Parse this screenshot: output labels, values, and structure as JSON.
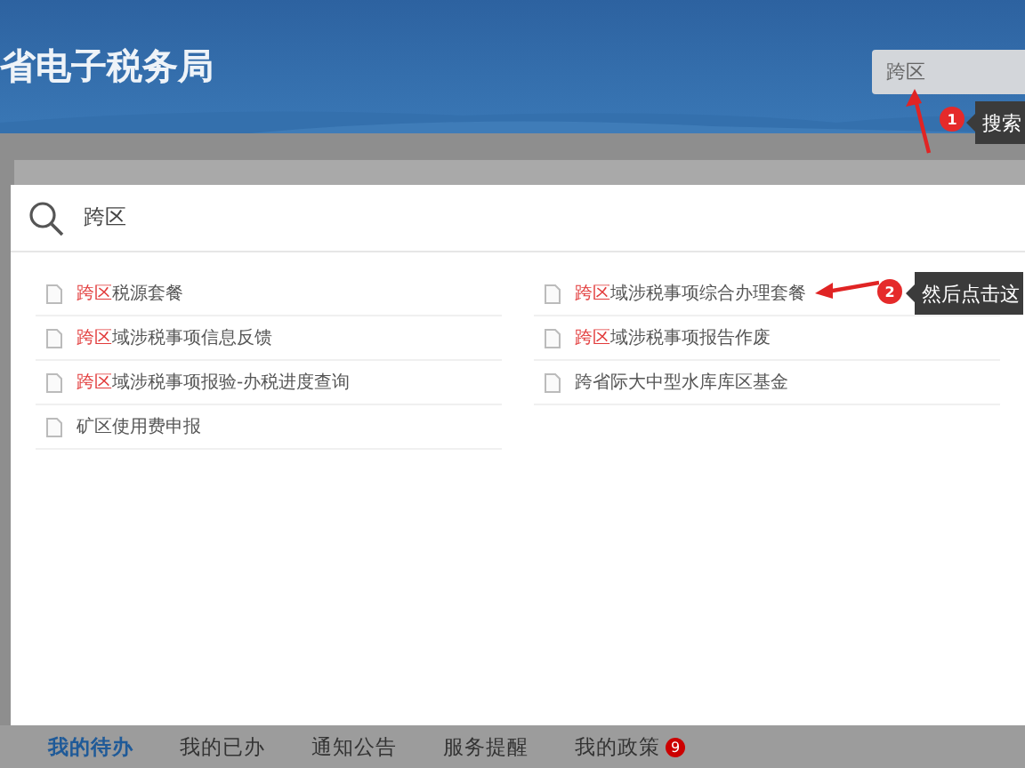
{
  "header": {
    "title": "省电子税务局",
    "search": {
      "value": "跨区"
    }
  },
  "search_panel": {
    "query": "跨区",
    "results": [
      {
        "match": "跨区",
        "text": "税源套餐"
      },
      {
        "match": "跨区",
        "text": "域涉税事项综合办理套餐"
      },
      {
        "match": "跨区",
        "text": "域涉税事项信息反馈"
      },
      {
        "match": "跨区",
        "text": "域涉税事项报告作废"
      },
      {
        "match": "跨区",
        "text": "域涉税事项报验-办税进度查询"
      },
      {
        "text": "跨省际大中型水库库区基金"
      },
      {
        "text": "矿区使用费申报"
      }
    ]
  },
  "guide_steps": [
    {
      "number": "1",
      "tip": "搜索",
      "kind": "up"
    },
    {
      "number": "2",
      "tip": "然后点击这",
      "kind": "left"
    }
  ],
  "bottom_tabs": [
    {
      "label": "我的待办",
      "selected": true
    },
    {
      "label": "我的已办",
      "selected": false
    },
    {
      "label": "通知公告",
      "selected": false
    },
    {
      "label": "服务提醒",
      "selected": false
    },
    {
      "label": "我的政策",
      "selected": false,
      "badge": "9"
    }
  ]
}
